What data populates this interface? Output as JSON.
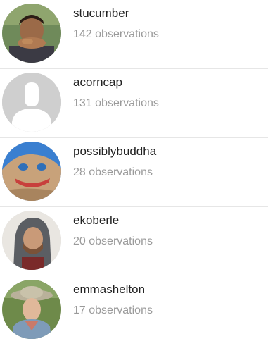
{
  "users": [
    {
      "username": "stucumber",
      "observations": "142 observations",
      "avatar": "photo-avatar-man-eating"
    },
    {
      "username": "acorncap",
      "observations": "131 observations",
      "avatar": "default-person-icon"
    },
    {
      "username": "possiblybuddha",
      "observations": "28 observations",
      "avatar": "photo-avatar-painted-rock"
    },
    {
      "username": "ekoberle",
      "observations": "20 observations",
      "avatar": "photo-avatar-hooded-man"
    },
    {
      "username": "emmashelton",
      "observations": "17 observations",
      "avatar": "photo-avatar-woman-hat"
    }
  ],
  "colors": {
    "username": "#222222",
    "count": "#9a9a9a",
    "divider": "#e6e6e6",
    "default_avatar_bg": "#cfcfcf"
  }
}
